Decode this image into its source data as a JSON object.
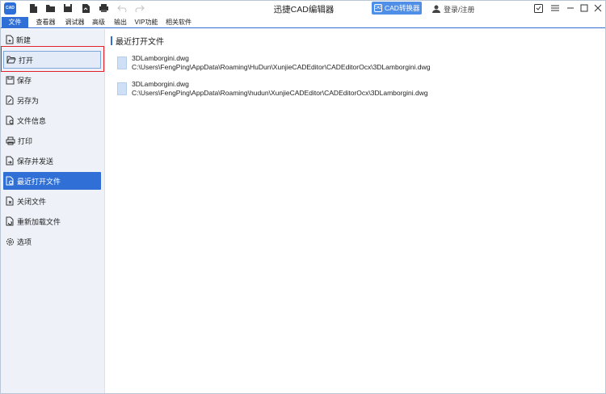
{
  "app": {
    "logo_text": "CAD",
    "title": "迅捷CAD编辑器",
    "cad_converter_label": "CAD转换器",
    "login_label": "登录/注册"
  },
  "menu": {
    "items": [
      {
        "label": "文件",
        "active": true
      },
      {
        "label": "查看器"
      },
      {
        "label": "调试器"
      },
      {
        "label": "高级"
      },
      {
        "label": "输出"
      },
      {
        "label": "VIP功能"
      },
      {
        "label": "相关软件"
      }
    ]
  },
  "sidebar": {
    "items": [
      {
        "label": "新建",
        "icon": "new-file-icon"
      },
      {
        "label": "打开",
        "icon": "folder-open-icon"
      },
      {
        "label": "保存",
        "icon": "save-icon"
      },
      {
        "label": "另存为",
        "icon": "save-as-icon"
      },
      {
        "label": "文件信息",
        "icon": "file-info-icon"
      },
      {
        "label": "打印",
        "icon": "print-icon"
      },
      {
        "label": "保存并发送",
        "icon": "save-send-icon"
      },
      {
        "label": "最近打开文件",
        "icon": "recent-files-icon"
      },
      {
        "label": "关闭文件",
        "icon": "close-file-icon"
      },
      {
        "label": "重新加载文件",
        "icon": "reload-file-icon"
      },
      {
        "label": "选项",
        "icon": "options-gear-icon"
      }
    ]
  },
  "content": {
    "title": "最近打开文件",
    "files": [
      {
        "name": "3DLamborgini.dwg",
        "path": "C:\\Users\\FengPing\\AppData\\Roaming\\HuDun\\XunjieCADEditor\\CADEditorOcx\\3DLamborgini.dwg"
      },
      {
        "name": "3DLamborgini.dwg",
        "path": "C:\\Users\\FengPing\\AppData\\Roaming\\hudun\\XunjieCADEditor\\CADEditorOcx\\3DLamborgini.dwg"
      }
    ]
  },
  "colors": {
    "accent": "#2f6fd6",
    "focus_highlight": "#e0232b",
    "sidebar_bg": "#eef2f8"
  }
}
